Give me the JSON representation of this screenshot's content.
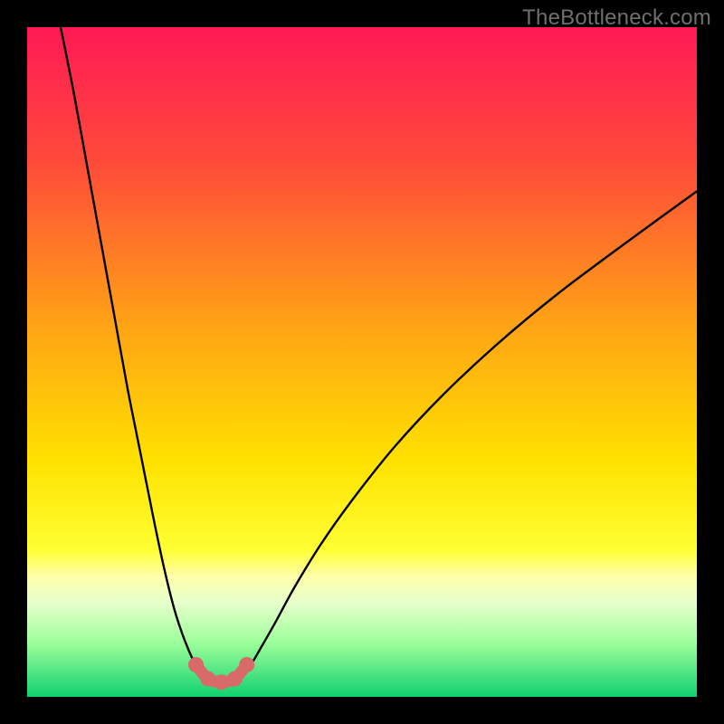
{
  "watermark": "TheBottleneck.com",
  "chart_data": {
    "type": "line",
    "title": "",
    "xlabel": "",
    "ylabel": "",
    "xlim": [
      0,
      100
    ],
    "ylim": [
      0,
      100
    ],
    "gradient_stops": [
      {
        "offset": 0,
        "color": "#ff1a55"
      },
      {
        "offset": 20,
        "color": "#ff4a3a"
      },
      {
        "offset": 45,
        "color": "#ffa514"
      },
      {
        "offset": 65,
        "color": "#ffe200"
      },
      {
        "offset": 78,
        "color": "#ffff33"
      },
      {
        "offset": 82,
        "color": "#ffffaa"
      },
      {
        "offset": 86,
        "color": "#e6ffcc"
      },
      {
        "offset": 92,
        "color": "#9cff99"
      },
      {
        "offset": 100,
        "color": "#10d070"
      }
    ],
    "series": [
      {
        "name": "left-branch",
        "x": [
          5,
          7,
          9,
          11,
          13,
          15,
          17,
          19,
          20.5,
          22,
          23.5,
          25,
          26,
          27
        ],
        "y": [
          100,
          90,
          79,
          68,
          57,
          46,
          36,
          26,
          19,
          13,
          8.5,
          5,
          3.3,
          2.6
        ]
      },
      {
        "name": "right-branch",
        "x": [
          31,
          32,
          33.5,
          35,
          37,
          40,
          44,
          49,
          55,
          62,
          70,
          79,
          89,
          100
        ],
        "y": [
          2.6,
          3.5,
          5,
          7.5,
          11,
          16.5,
          23,
          30,
          37.5,
          45,
          52.5,
          60,
          67.5,
          75.5
        ]
      }
    ],
    "valley_marker": {
      "name": "valley-marker",
      "color": "#d96a6a",
      "x": [
        25.2,
        27.0,
        29.0,
        31.0,
        32.8
      ],
      "y": [
        4.8,
        2.7,
        2.2,
        2.7,
        4.8
      ]
    }
  }
}
